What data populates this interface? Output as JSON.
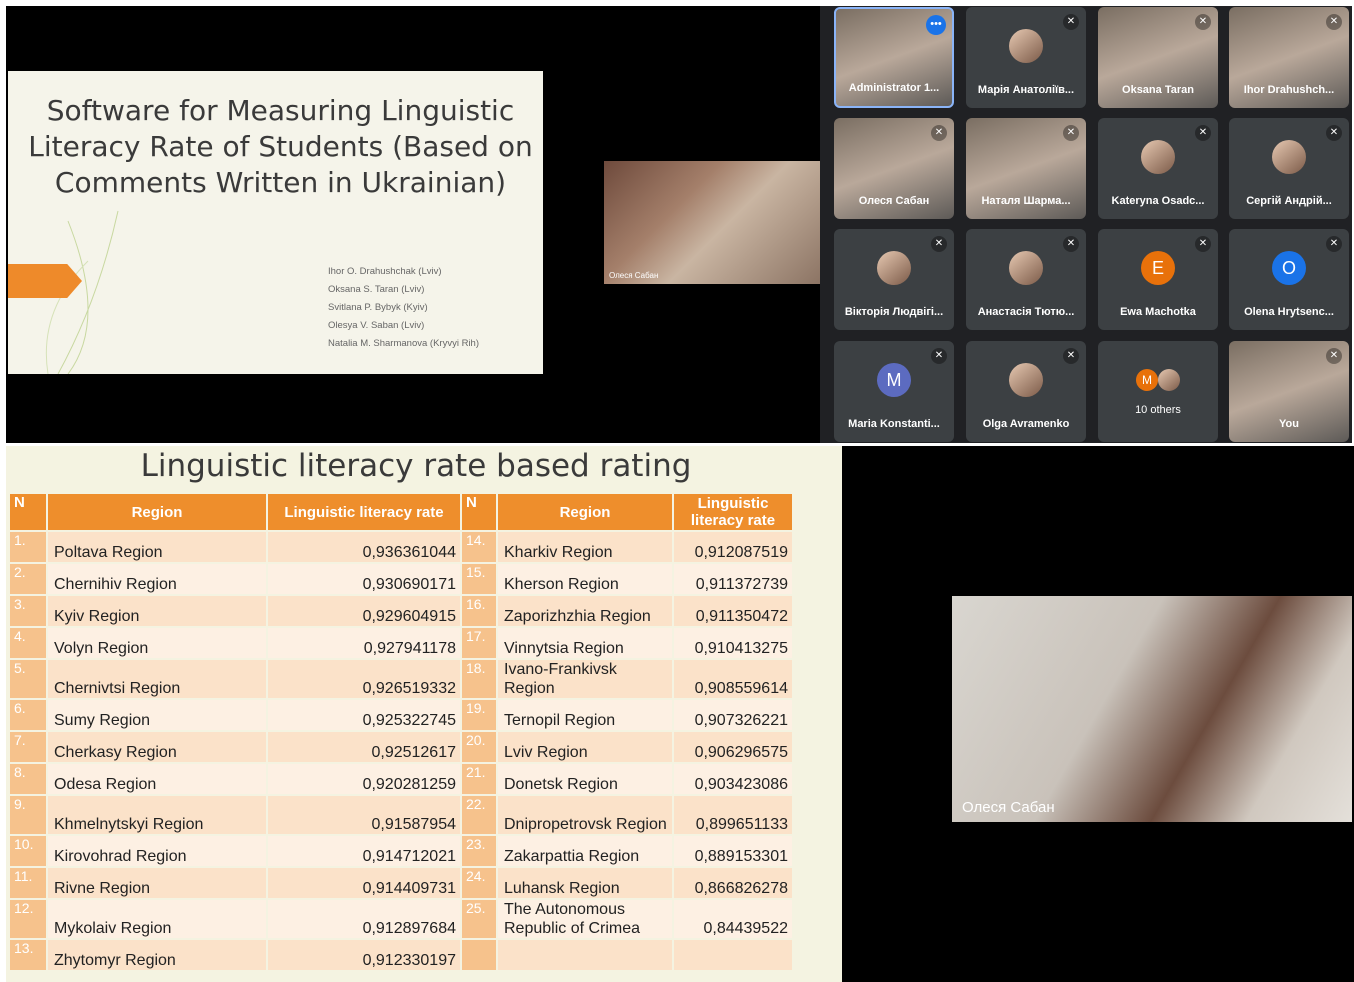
{
  "slide1": {
    "title": "Software for Measuring Linguistic Literacy Rate of Students (Based on Comments Written in Ukrainian)",
    "authors": [
      "Ihor O. Drahushchak (Lviv)",
      "Oksana S. Taran (Lviv)",
      "Svitlana P. Bybyk (Kyiv)",
      "Olesya V. Saban (Lviv)",
      "Natalia M. Sharmanova (Kryvyi Rih)"
    ]
  },
  "speaker_small": {
    "name": "Олеся Сабан"
  },
  "speaker_large": {
    "name": "Олеся Сабан"
  },
  "participants": [
    {
      "name": "Administrator 1...",
      "kind": "photo",
      "active": true
    },
    {
      "name": "Марія Анатоліїв...",
      "kind": "avatar-photo"
    },
    {
      "name": "Oksana Taran",
      "kind": "photo"
    },
    {
      "name": "Ihor Drahushch...",
      "kind": "photo"
    },
    {
      "name": "Олеся Сабан",
      "kind": "photo"
    },
    {
      "name": "Наталя Шарма...",
      "kind": "photo"
    },
    {
      "name": "Kateryna Osadc...",
      "kind": "avatar-photo"
    },
    {
      "name": "Сергій Андрій...",
      "kind": "avatar-photo"
    },
    {
      "name": "Вікторія Людвігі...",
      "kind": "avatar-photo"
    },
    {
      "name": "Анастасія Тютю...",
      "kind": "avatar-photo"
    },
    {
      "name": "Ewa Machotka",
      "kind": "letter",
      "letter": "E",
      "color": "#e8710a"
    },
    {
      "name": "Olena Hrytsenc...",
      "kind": "letter",
      "letter": "O",
      "color": "#1a73e8"
    },
    {
      "name": "Maria Konstanti...",
      "kind": "letter",
      "letter": "M",
      "color": "#5c6bc0"
    },
    {
      "name": "Olga Avramenko",
      "kind": "avatar-photo"
    },
    {
      "name": "10 others",
      "kind": "others",
      "letter": "M",
      "color": "#e8710a"
    },
    {
      "name": "You",
      "kind": "photo"
    }
  ],
  "slide2": {
    "title": "Linguistic literacy rate based rating",
    "headers_left": [
      "N",
      "Region",
      "Linguistic literacy rate"
    ],
    "headers_right": [
      "N",
      "Region",
      "Linguistic literacy rate"
    ],
    "rows": [
      {
        "n1": "1.",
        "r1": "Poltava Region",
        "v1": "0,936361044",
        "n2": "14.",
        "r2": "Kharkiv Region",
        "v2": "0,912087519"
      },
      {
        "n1": "2.",
        "r1": "Chernihiv Region",
        "v1": "0,930690171",
        "n2": "15.",
        "r2": "Kherson Region",
        "v2": "0,911372739"
      },
      {
        "n1": "3.",
        "r1": "Kyiv Region",
        "v1": "0,929604915",
        "n2": "16.",
        "r2": "Zaporizhzhia Region",
        "v2": "0,911350472"
      },
      {
        "n1": "4.",
        "r1": "Volyn Region",
        "v1": "0,927941178",
        "n2": "17.",
        "r2": "Vinnytsia Region",
        "v2": "0,910413275"
      },
      {
        "n1": "5.",
        "r1": "Chernivtsi Region",
        "v1": "0,926519332",
        "n2": "18.",
        "r2": "Ivano-Frankivsk Region",
        "v2": "0,908559614"
      },
      {
        "n1": "6.",
        "r1": "Sumy Region",
        "v1": "0,925322745",
        "n2": "19.",
        "r2": "Ternopil Region",
        "v2": "0,907326221"
      },
      {
        "n1": "7.",
        "r1": "Cherkasy Region",
        "v1": "0,92512617",
        "n2": "20.",
        "r2": "Lviv Region",
        "v2": "0,906296575"
      },
      {
        "n1": "8.",
        "r1": "Odesa Region",
        "v1": "0,920281259",
        "n2": "21.",
        "r2": "Donetsk Region",
        "v2": "0,903423086"
      },
      {
        "n1": "9.",
        "r1": "Khmelnytskyi Region",
        "v1": "0,91587954",
        "n2": "22.",
        "r2": "Dnipropetrovsk Region",
        "v2": "0,899651133"
      },
      {
        "n1": "10.",
        "r1": "Kirovohrad Region",
        "v1": "0,914712021",
        "n2": "23.",
        "r2": "Zakarpattia Region",
        "v2": "0,889153301"
      },
      {
        "n1": "11.",
        "r1": "Rivne Region",
        "v1": "0,914409731",
        "n2": "24.",
        "r2": "Luhansk Region",
        "v2": "0,866826278"
      },
      {
        "n1": "12.",
        "r1": "Mykolaiv Region",
        "v1": "0,912897684",
        "n2": "25.",
        "r2": "The Autonomous Republic of Crimea",
        "v2": "0,84439522"
      },
      {
        "n1": "13.",
        "r1": "Zhytomyr Region",
        "v1": "0,912330197",
        "n2": "",
        "r2": "",
        "v2": ""
      }
    ]
  }
}
